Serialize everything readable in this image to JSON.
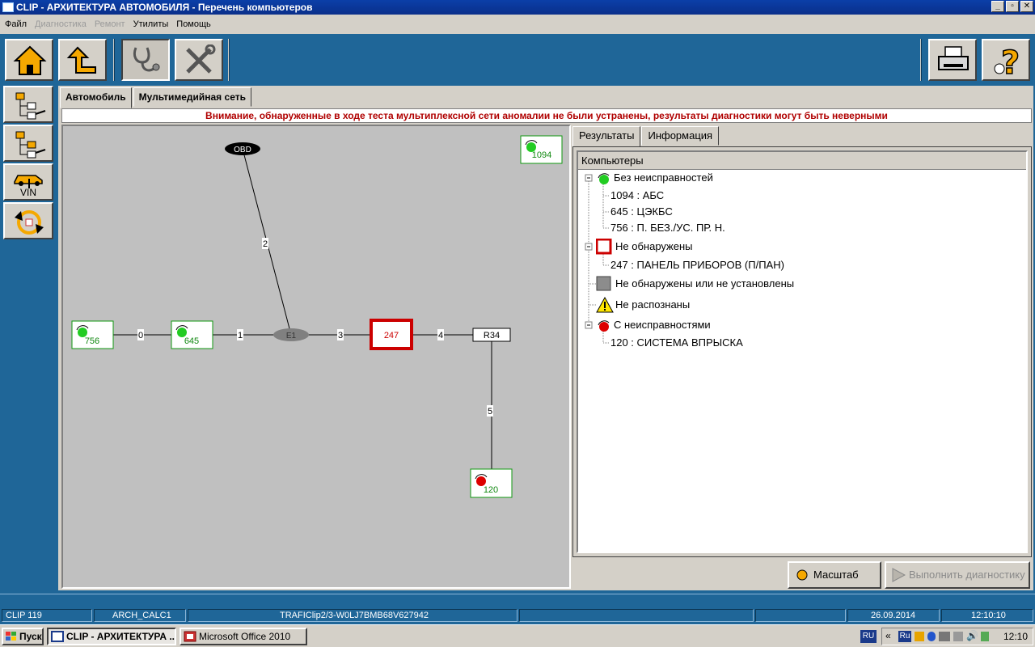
{
  "window": {
    "title": "CLIP - АРХИТЕКТУРА АВТОМОБИЛЯ - Перечень компьютеров",
    "buttons": [
      "_",
      "▫",
      "✕"
    ]
  },
  "menu": [
    {
      "label": "Файл",
      "enabled": true
    },
    {
      "label": "Диагностика",
      "enabled": false
    },
    {
      "label": "Ремонт",
      "enabled": false
    },
    {
      "label": "Утилиты",
      "enabled": true
    },
    {
      "label": "Помощь",
      "enabled": true
    }
  ],
  "toolbar": {
    "icons": [
      "home-icon",
      "up-arrow-icon",
      "stethoscope-icon",
      "tools-icon",
      "printer-icon",
      "help-icon"
    ]
  },
  "sidebar": {
    "icons": [
      "tree-select-icon",
      "tree-compare-icon",
      "vin-car-icon",
      "refresh-icon"
    ],
    "vin_label": "VIN"
  },
  "main_tabs": [
    {
      "label": "Автомобиль",
      "active": true
    },
    {
      "label": "Мультимедийная сеть",
      "active": false
    }
  ],
  "warning_text": "Внимание, обнаруженные в ходе теста мультиплексной сети аномалии не были устранены, результаты диагностики могут быть неверными",
  "diagram": {
    "nodes": {
      "obd": "OBD",
      "e1": "E1",
      "r34": "R34",
      "n247": "247",
      "n756": "756",
      "n645": "645",
      "n1094": "1094",
      "n120": "120"
    },
    "links": [
      "0",
      "1",
      "2",
      "3",
      "4",
      "5"
    ],
    "colors": {
      "ok": "#22cc22",
      "fault": "#dd0000",
      "missing": "#cc0000",
      "text_ok": "#118811"
    }
  },
  "right_tabs": [
    {
      "label": "Результаты",
      "active": true
    },
    {
      "label": "Информация",
      "active": false
    }
  ],
  "tree": {
    "header": "Компьютеры",
    "groups": [
      {
        "label": "Без неисправностей",
        "status": "ok",
        "items": [
          "1094 : АБС",
          "645 : ЦЭКБС",
          "756 : П. БЕЗ./УС. ПР. Н."
        ]
      },
      {
        "label": "Не обнаружены",
        "status": "missing",
        "items": [
          "247 : ПАНЕЛЬ ПРИБОРОВ (П/ПАН)"
        ]
      },
      {
        "label": "Не обнаружены или не установлены",
        "status": "not-installed",
        "items": []
      },
      {
        "label": "Не распознаны",
        "status": "unknown",
        "items": []
      },
      {
        "label": "С неисправностями",
        "status": "fault",
        "items": [
          "120 : СИСТЕМА ВПРЫСКА"
        ]
      }
    ]
  },
  "buttons": {
    "zoom": "Масштаб",
    "run_diag": "Выполнить диагностику"
  },
  "status": {
    "version": "CLIP 119",
    "module": "ARCH_CALC1",
    "vehicle": "TRAFIClip2/3-W0LJ7BMB68V627942",
    "date": "26.09.2014",
    "time": "12:10:10"
  },
  "taskbar": {
    "start": "Пуск",
    "tasks": [
      {
        "label": "CLIP - АРХИТЕКТУРА ...",
        "active": true
      },
      {
        "label": "Microsoft Office 2010",
        "active": false
      }
    ],
    "lang": "RU",
    "tray_lang": "Ru",
    "clock": "12:10"
  }
}
